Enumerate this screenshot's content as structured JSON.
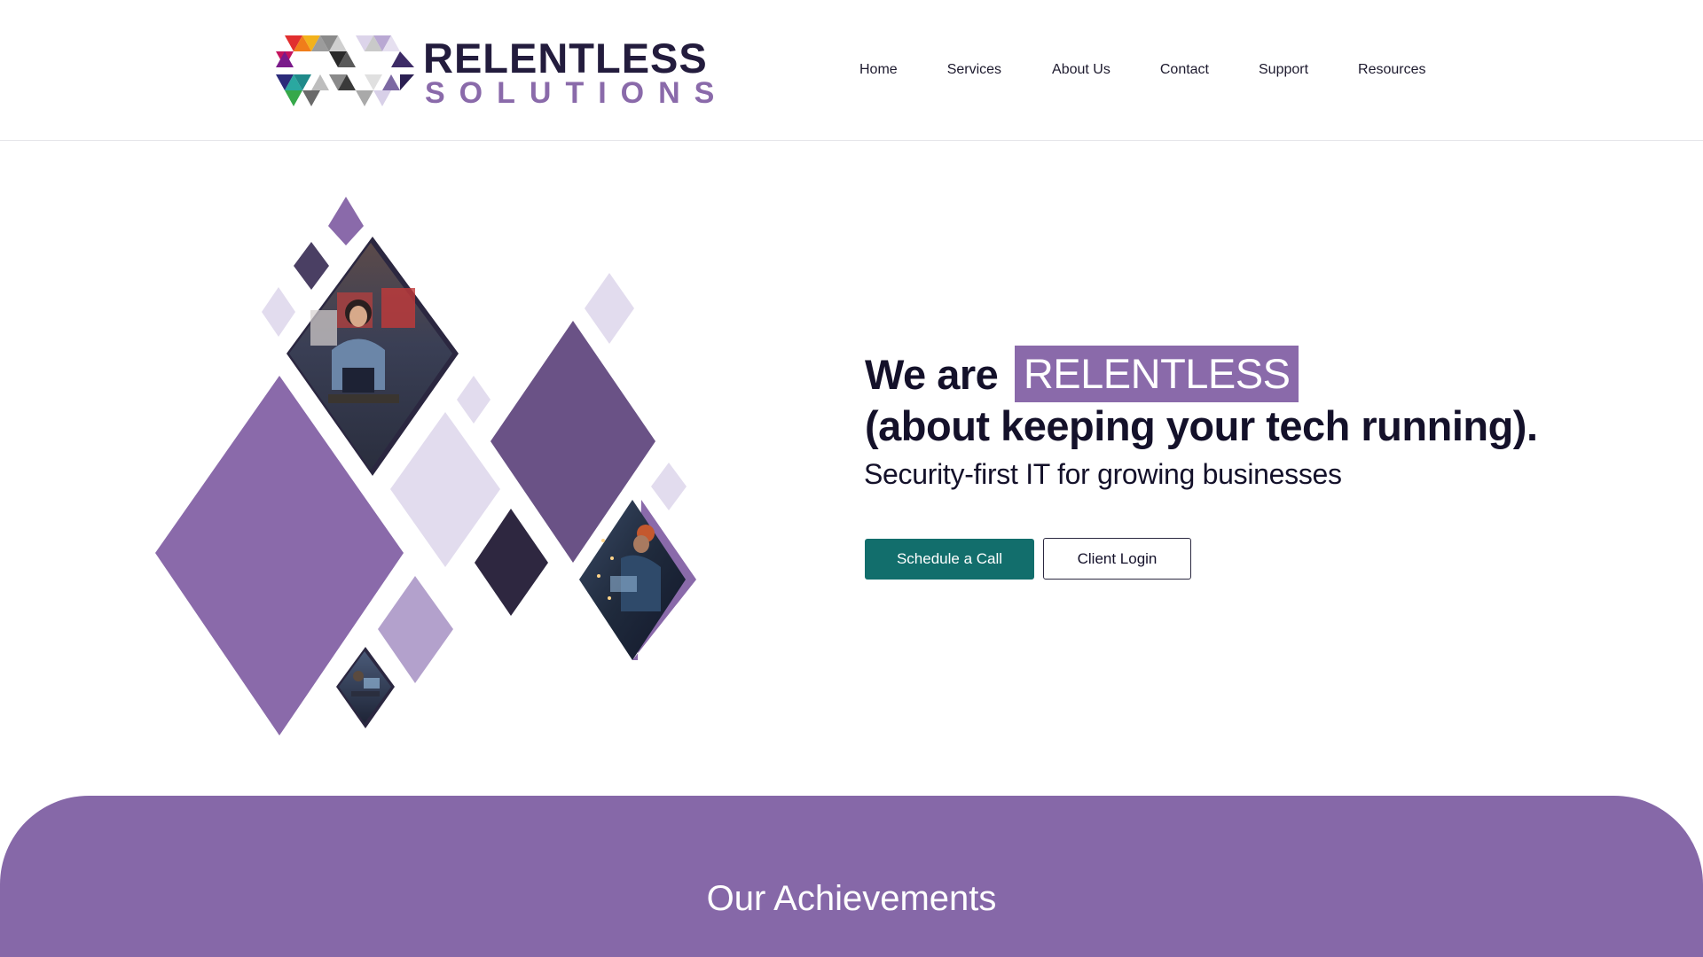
{
  "brand": {
    "name_line1": "RELENTLESS",
    "name_line2": "SOLUTIONS",
    "colors": {
      "primary_purple": "#8a6aaa",
      "dark_navy": "#231c3d",
      "teal": "#126e6c"
    }
  },
  "nav": {
    "items": [
      {
        "label": "Home"
      },
      {
        "label": "Services"
      },
      {
        "label": "About Us"
      },
      {
        "label": "Contact"
      },
      {
        "label": "Support"
      },
      {
        "label": "Resources"
      }
    ]
  },
  "hero": {
    "title_prefix": "We are",
    "title_highlight": "RELENTLESS",
    "title_line2": "(about keeping your tech running).",
    "subtitle": "Security-first IT for growing businesses",
    "primary_button": "Schedule a Call",
    "secondary_button": "Client Login",
    "graphic_icons": [
      "diamond-mosaic",
      "photo-cashier",
      "photo-technician",
      "photo-workstation"
    ]
  },
  "achievements": {
    "heading": "Our Achievements"
  }
}
